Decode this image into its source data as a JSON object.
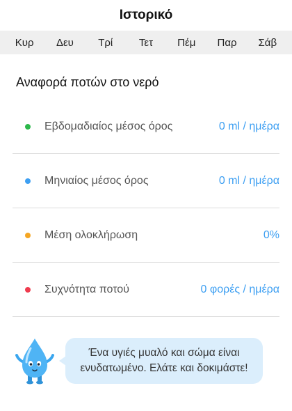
{
  "header": {
    "title": "Ιστορικό"
  },
  "week_days": [
    "Κυρ",
    "Δευ",
    "Τρί",
    "Τετ",
    "Πέμ",
    "Παρ",
    "Σάβ"
  ],
  "report": {
    "title": "Αναφορά ποτών στο νερό",
    "rows": [
      {
        "label": "Εβδομαδιαίος μέσος όρος",
        "value": "0 ml / ημέρα",
        "dot_color": "#2db84b"
      },
      {
        "label": "Μηνιαίος μέσος όρος",
        "value": "0 ml / ημέρα",
        "dot_color": "#3d9ff2"
      },
      {
        "label": "Μέση ολοκλήρωση",
        "value": "0%",
        "dot_color": "#f5a623"
      },
      {
        "label": "Συχνότητα ποτού",
        "value": "0 φορές / ημέρα",
        "dot_color": "#ef3b4e"
      }
    ]
  },
  "tip": {
    "mascot_icon": "water-drop-mascot-icon",
    "line1": "Ένα υγιές μυαλό και σώμα είναι",
    "line2": "ενυδατωμένο. Ελάτε και δοκιμάστε!"
  },
  "colors": {
    "accent": "#3d9ff2",
    "bubble": "#dbeefc",
    "day_bar": "#efefef"
  }
}
